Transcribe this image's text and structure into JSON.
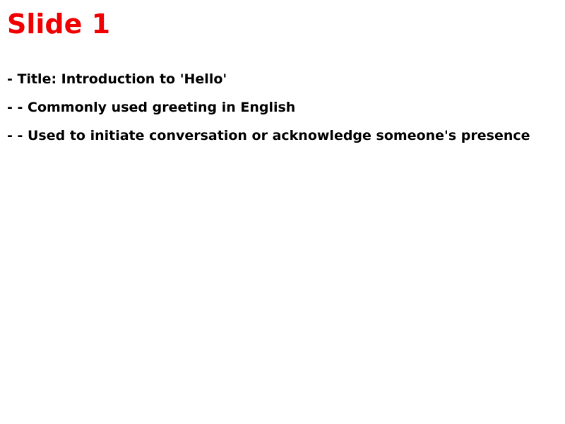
{
  "slide": {
    "title": "Slide 1",
    "title_color": "#f00000",
    "bullets": [
      "- Title: Introduction to 'Hello'",
      "- - Commonly used greeting in English",
      "- - Used to initiate conversation or acknowledge someone's presence"
    ]
  }
}
